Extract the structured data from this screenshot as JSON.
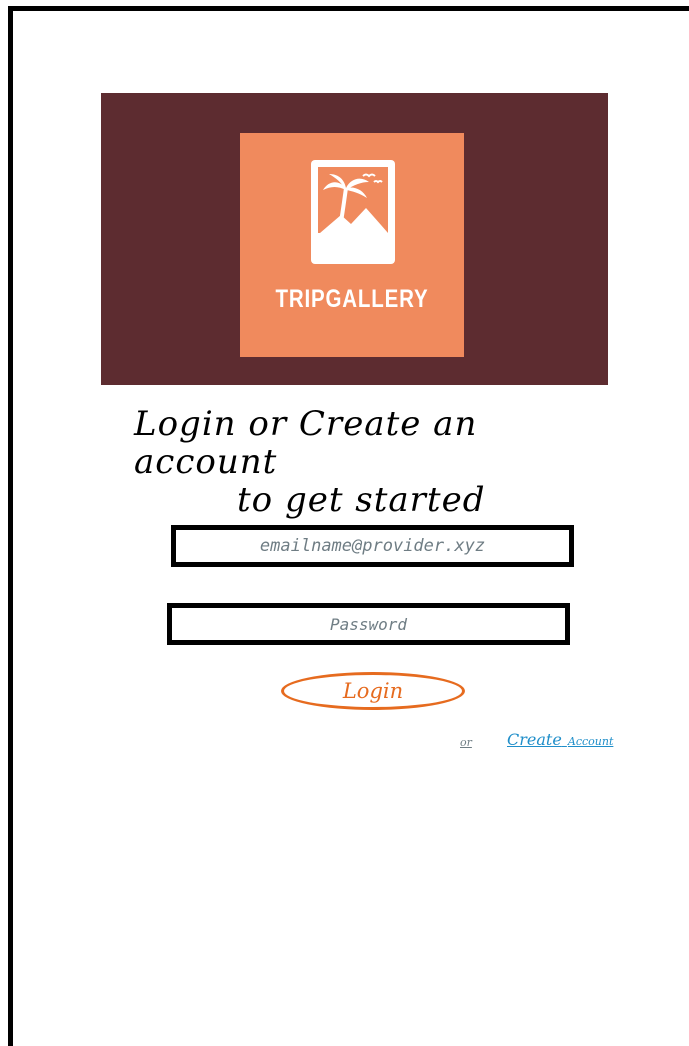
{
  "brand": {
    "name": "TRIPGALLERY"
  },
  "headline": {
    "line1": "Login or Create an account",
    "line2": "to get started"
  },
  "form": {
    "email_placeholder": "emailname@provider.xyz",
    "password_placeholder": "Password",
    "login_label": "Login"
  },
  "footer": {
    "or_text": "or",
    "create_account_main": "Create",
    "create_account_small": "Account"
  },
  "colors": {
    "hero_bg": "#5d2c30",
    "logo_bg": "#f08a5d",
    "login_accent": "#e66b1f",
    "link": "#1f8ec9",
    "placeholder": "#6f7d84"
  },
  "icons": {
    "logo": "photo-frame-palm-tree-icon"
  }
}
